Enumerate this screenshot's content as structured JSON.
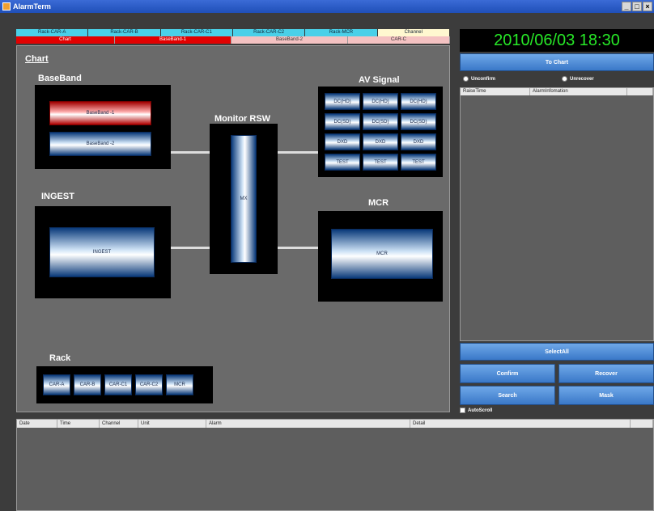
{
  "window": {
    "title": "AlarmTerm",
    "controls": [
      "_",
      "□",
      "×"
    ]
  },
  "tabs": {
    "top": [
      "Rack-CAR-A",
      "Rack-CAR-B",
      "Rack-CAR-C1",
      "Rack-CAR-C2",
      "Rack-MCR",
      "Channel"
    ],
    "bottom": [
      "Chart",
      "BaseBand-1",
      "BaseBand-2",
      "CAR-C"
    ]
  },
  "chart": {
    "title": "Chart",
    "baseband": {
      "label": "BaseBand",
      "items": [
        "BaseBand -1",
        "BaseBand -2"
      ]
    },
    "ingest": {
      "label": "INGEST",
      "item": "INGEST"
    },
    "monitor": {
      "label": "Monitor RSW",
      "item": "MX"
    },
    "av_signal": {
      "label": "AV Signal",
      "grid": [
        [
          "DC(HD)",
          "DC(HD)",
          "DC(HD)"
        ],
        [
          "DC(SD)",
          "DC(SD)",
          "DC(SD)"
        ],
        [
          "DXD",
          "DXD",
          "DXD"
        ],
        [
          "TEST",
          "TEST",
          "TEST"
        ]
      ]
    },
    "mcr": {
      "label": "MCR",
      "item": "MCR"
    },
    "rack": {
      "label": "Rack",
      "items": [
        "CAR-A",
        "CAR-B",
        "CAR-C1",
        "CAR-C2",
        "MCR"
      ]
    }
  },
  "right": {
    "clock": "2010/06/03 18:30",
    "to_chart": "To Chart",
    "radio_unconfirm": "Unconfirm",
    "radio_unrecover": "Unrecover",
    "alarm_columns": [
      "RaiseTime",
      "AlarmInfomation"
    ],
    "select_all": "SelectAll",
    "confirm": "Confirm",
    "recover": "Recover",
    "search": "Search",
    "mask": "Mask",
    "autoscroll": "AutoScroll"
  },
  "log": {
    "columns": [
      "Date",
      "Time",
      "Channel",
      "Unit",
      "Alarm",
      "Detail"
    ]
  },
  "colors": {
    "clock_text": "#27e827",
    "active_tab": "#e20000",
    "tab_top": "#4ad0e8"
  }
}
